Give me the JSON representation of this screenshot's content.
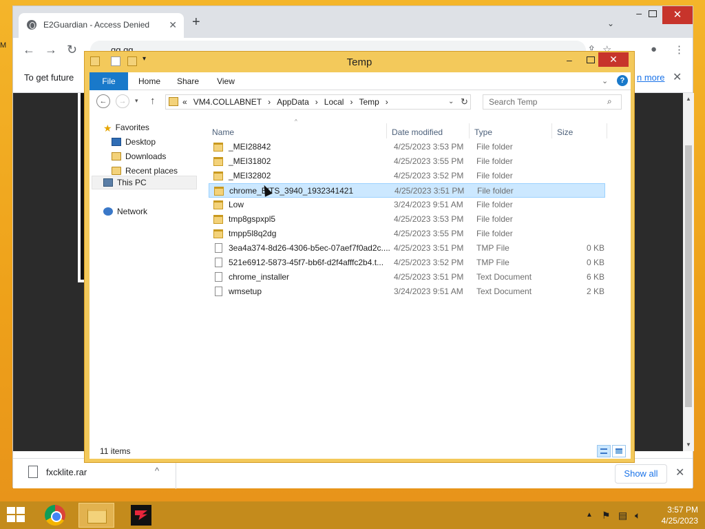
{
  "desktop": {
    "edge_text": "M"
  },
  "chrome": {
    "tab": {
      "title": "E2Guardian - Access Denied",
      "close": "✕"
    },
    "newtab": "+",
    "tablist": "⌄",
    "window": {
      "minimize": "–",
      "close": "✕"
    },
    "toolbar": {
      "back": "←",
      "forward": "→",
      "reload": "↻",
      "url": "gg.gg",
      "share": "⇪",
      "star": "☆",
      "profile": "●",
      "menu": "⋮"
    },
    "infobar": {
      "message": "To get future",
      "link": "n more",
      "close": "✕"
    },
    "downloads": {
      "file": "fxcklite.rar",
      "chevron": "^",
      "show_all": "Show all",
      "close": "✕"
    }
  },
  "explorer": {
    "title": "Temp",
    "window": {
      "minimize": "–",
      "close": "✕"
    },
    "ribbon": {
      "tabs": [
        "File",
        "Home",
        "Share",
        "View"
      ],
      "collapse": "⌄",
      "help": "?"
    },
    "nav": {
      "back": "←",
      "forward": "→",
      "recent": "▾",
      "up": "↑"
    },
    "address": {
      "crumbs": [
        "«",
        "VM4.COLLABNET",
        "›",
        "AppData",
        "›",
        "Local",
        "›",
        "Temp",
        "›"
      ],
      "dropdown": "⌄",
      "refresh": "↻"
    },
    "search": {
      "placeholder": "Search Temp",
      "icon": "⌕"
    },
    "navpane": {
      "favorites": "Favorites",
      "desktop": "Desktop",
      "downloads": "Downloads",
      "recent": "Recent places",
      "this_pc": "This PC",
      "network": "Network"
    },
    "columns": {
      "name": "Name",
      "date": "Date modified",
      "type": "Type",
      "size": "Size",
      "sort_indicator": "^"
    },
    "files": [
      {
        "name": "_MEI28842",
        "date": "4/25/2023 3:53 PM",
        "type": "File folder",
        "size": "",
        "kind": "folder"
      },
      {
        "name": "_MEI31802",
        "date": "4/25/2023 3:55 PM",
        "type": "File folder",
        "size": "",
        "kind": "folder"
      },
      {
        "name": "_MEI32802",
        "date": "4/25/2023 3:52 PM",
        "type": "File folder",
        "size": "",
        "kind": "folder"
      },
      {
        "name": "chrome_BITS_3940_1932341421",
        "date": "4/25/2023 3:51 PM",
        "type": "File folder",
        "size": "",
        "kind": "folder",
        "selected": true
      },
      {
        "name": "Low",
        "date": "3/24/2023 9:51 AM",
        "type": "File folder",
        "size": "",
        "kind": "folder"
      },
      {
        "name": "tmp8gspxpl5",
        "date": "4/25/2023 3:53 PM",
        "type": "File folder",
        "size": "",
        "kind": "folder"
      },
      {
        "name": "tmpp5l8q2dg",
        "date": "4/25/2023 3:55 PM",
        "type": "File folder",
        "size": "",
        "kind": "folder"
      },
      {
        "name": "3ea4a374-8d26-4306-b5ec-07aef7f0ad2c....",
        "date": "4/25/2023 3:51 PM",
        "type": "TMP File",
        "size": "0 KB",
        "kind": "file"
      },
      {
        "name": "521e6912-5873-45f7-bb6f-d2f4afffc2b4.t...",
        "date": "4/25/2023 3:52 PM",
        "type": "TMP File",
        "size": "0 KB",
        "kind": "file"
      },
      {
        "name": "chrome_installer",
        "date": "4/25/2023 3:51 PM",
        "type": "Text Document",
        "size": "6 KB",
        "kind": "file"
      },
      {
        "name": "wmsetup",
        "date": "3/24/2023 9:51 AM",
        "type": "Text Document",
        "size": "2 KB",
        "kind": "file"
      }
    ],
    "status": {
      "count": "11 items"
    }
  },
  "taskbar": {
    "tray_chevron": "▲",
    "clock": {
      "time": "3:57 PM",
      "date": "4/25/2023"
    }
  },
  "colors": {
    "explorer_accent": "#1979ca",
    "selection": "#cce8ff",
    "close_red": "#c7342b",
    "desktop": "#f0a81e"
  }
}
